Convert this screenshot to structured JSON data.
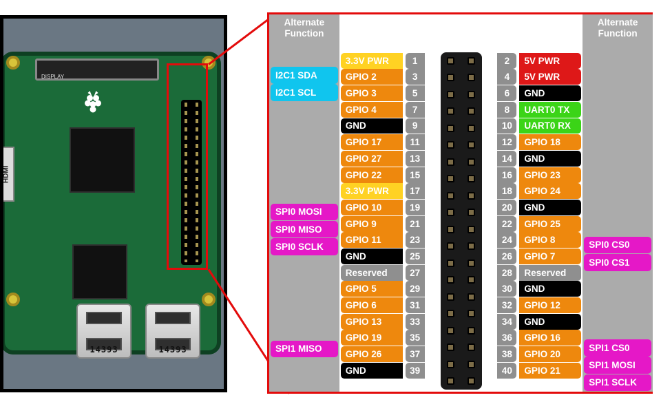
{
  "usb_label": "14393",
  "hdmi_label": "HDMI",
  "headers": {
    "alt": "Alternate Function"
  },
  "pins_left": [
    {
      "n": 1,
      "func": "3.3V PWR",
      "c": "yellow",
      "alt": null,
      "altc": null
    },
    {
      "n": 3,
      "func": "GPIO 2",
      "c": "orange",
      "alt": "I2C1 SDA",
      "altc": "cyan"
    },
    {
      "n": 5,
      "func": "GPIO 3",
      "c": "orange",
      "alt": "I2C1 SCL",
      "altc": "cyan"
    },
    {
      "n": 7,
      "func": "GPIO 4",
      "c": "orange",
      "alt": null,
      "altc": null
    },
    {
      "n": 9,
      "func": "GND",
      "c": "black",
      "alt": null,
      "altc": null
    },
    {
      "n": 11,
      "func": "GPIO 17",
      "c": "orange",
      "alt": null,
      "altc": null
    },
    {
      "n": 13,
      "func": "GPIO 27",
      "c": "orange",
      "alt": null,
      "altc": null
    },
    {
      "n": 15,
      "func": "GPIO 22",
      "c": "orange",
      "alt": null,
      "altc": null
    },
    {
      "n": 17,
      "func": "3.3V PWR",
      "c": "yellow",
      "alt": null,
      "altc": null
    },
    {
      "n": 19,
      "func": "GPIO 10",
      "c": "orange",
      "alt": "SPI0 MOSI",
      "altc": "magenta"
    },
    {
      "n": 21,
      "func": "GPIO 9",
      "c": "orange",
      "alt": "SPI0 MISO",
      "altc": "magenta"
    },
    {
      "n": 23,
      "func": "GPIO 11",
      "c": "orange",
      "alt": "SPI0 SCLK",
      "altc": "magenta"
    },
    {
      "n": 25,
      "func": "GND",
      "c": "black",
      "alt": null,
      "altc": null
    },
    {
      "n": 27,
      "func": "Reserved",
      "c": "gray",
      "alt": null,
      "altc": null
    },
    {
      "n": 29,
      "func": "GPIO 5",
      "c": "orange",
      "alt": null,
      "altc": null
    },
    {
      "n": 31,
      "func": "GPIO 6",
      "c": "orange",
      "alt": null,
      "altc": null
    },
    {
      "n": 33,
      "func": "GPIO 13",
      "c": "orange",
      "alt": null,
      "altc": null
    },
    {
      "n": 35,
      "func": "GPIO 19",
      "c": "orange",
      "alt": "SPI1 MISO",
      "altc": "magenta"
    },
    {
      "n": 37,
      "func": "GPIO 26",
      "c": "orange",
      "alt": null,
      "altc": null
    },
    {
      "n": 39,
      "func": "GND",
      "c": "black",
      "alt": null,
      "altc": null
    }
  ],
  "pins_right": [
    {
      "n": 2,
      "func": "5V PWR",
      "c": "red",
      "alt": null,
      "altc": null
    },
    {
      "n": 4,
      "func": "5V PWR",
      "c": "red",
      "alt": null,
      "altc": null
    },
    {
      "n": 6,
      "func": "GND",
      "c": "black",
      "alt": null,
      "altc": null
    },
    {
      "n": 8,
      "func": "UART0 TX",
      "c": "green",
      "alt": null,
      "altc": null
    },
    {
      "n": 10,
      "func": "UART0 RX",
      "c": "green",
      "alt": null,
      "altc": null
    },
    {
      "n": 12,
      "func": "GPIO 18",
      "c": "orange",
      "alt": null,
      "altc": null
    },
    {
      "n": 14,
      "func": "GND",
      "c": "black",
      "alt": null,
      "altc": null
    },
    {
      "n": 16,
      "func": "GPIO 23",
      "c": "orange",
      "alt": null,
      "altc": null
    },
    {
      "n": 18,
      "func": "GPIO 24",
      "c": "orange",
      "alt": null,
      "altc": null
    },
    {
      "n": 20,
      "func": "GND",
      "c": "black",
      "alt": null,
      "altc": null
    },
    {
      "n": 22,
      "func": "GPIO 25",
      "c": "orange",
      "alt": null,
      "altc": null
    },
    {
      "n": 24,
      "func": "GPIO 8",
      "c": "orange",
      "alt": "SPI0 CS0",
      "altc": "magenta"
    },
    {
      "n": 26,
      "func": "GPIO 7",
      "c": "orange",
      "alt": "SPI0 CS1",
      "altc": "magenta"
    },
    {
      "n": 28,
      "func": "Reserved",
      "c": "gray",
      "alt": null,
      "altc": null
    },
    {
      "n": 30,
      "func": "GND",
      "c": "black",
      "alt": null,
      "altc": null
    },
    {
      "n": 32,
      "func": "GPIO 12",
      "c": "orange",
      "alt": null,
      "altc": null
    },
    {
      "n": 34,
      "func": "GND",
      "c": "black",
      "alt": null,
      "altc": null
    },
    {
      "n": 36,
      "func": "GPIO 16",
      "c": "orange",
      "alt": "SPI1 CS0",
      "altc": "magenta"
    },
    {
      "n": 38,
      "func": "GPIO 20",
      "c": "orange",
      "alt": "SPI1 MOSI",
      "altc": "magenta"
    },
    {
      "n": 40,
      "func": "GPIO 21",
      "c": "orange",
      "alt": "SPI1 SCLK",
      "altc": "magenta"
    }
  ]
}
